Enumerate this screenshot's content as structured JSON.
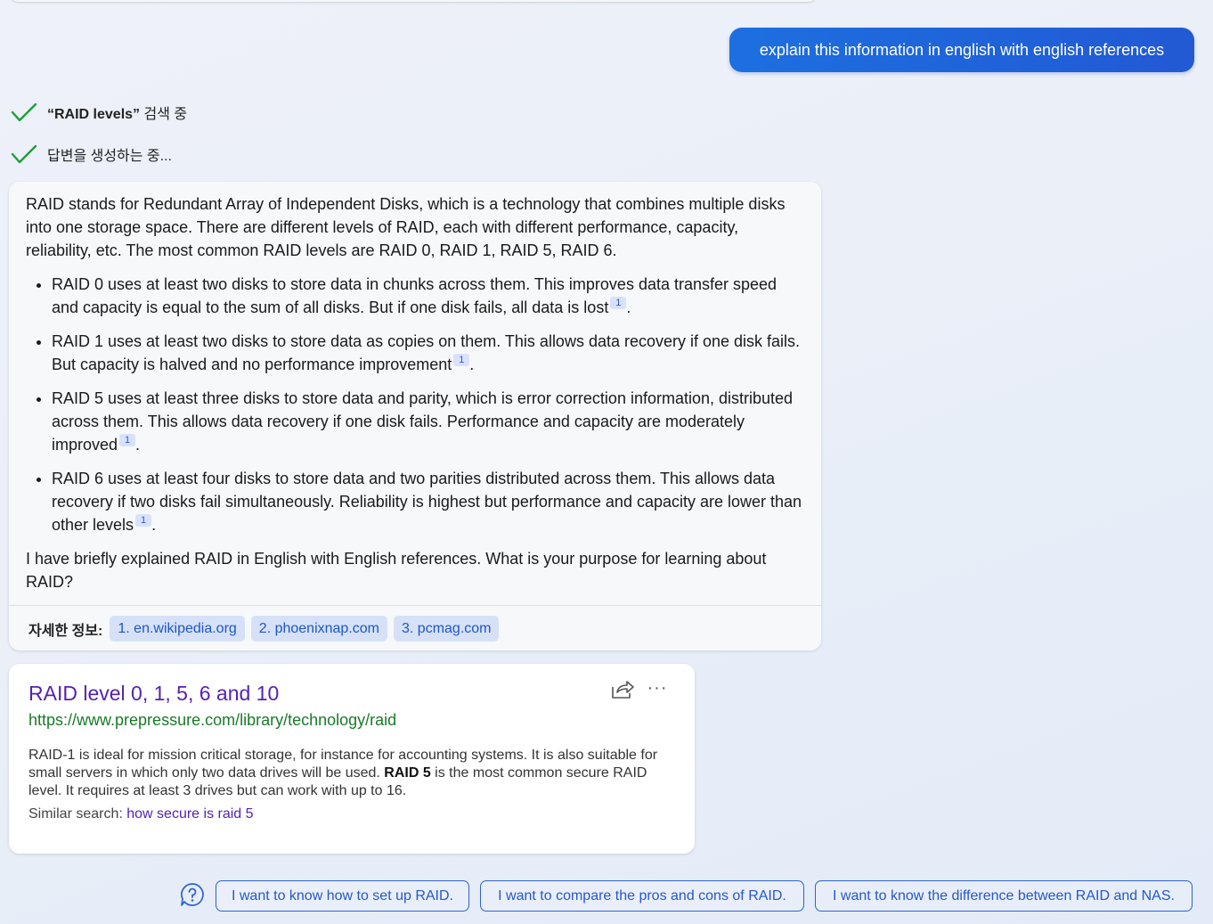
{
  "user_message": "explain this information in english with english references",
  "status": [
    {
      "bold": "“RAID levels”",
      "text": " 검색 중"
    },
    {
      "bold": "",
      "text": "답변을 생성하는 중..."
    }
  ],
  "answer": {
    "intro": "RAID stands for Redundant Array of Independent Disks, which is a technology that combines multiple disks into one storage space. There are different levels of RAID, each with different performance, capacity, reliability, etc. The most common RAID levels are RAID 0, RAID 1, RAID 5, RAID 6.",
    "bullets": [
      {
        "text": "RAID 0 uses at least two disks to store data in chunks across them. This improves data transfer speed and capacity is equal to the sum of all disks. But if one disk fails, all data is lost",
        "cite": "1"
      },
      {
        "text": "RAID 1 uses at least two disks to store data as copies on them. This allows data recovery if one disk fails. But capacity is halved and no performance improvement",
        "cite": "1"
      },
      {
        "text": "RAID 5 uses at least three disks to store data and parity, which is error correction information, distributed across them. This allows data recovery if one disk fails. Performance and capacity are moderately improved",
        "cite": "1"
      },
      {
        "text": "RAID 6 uses at least four disks to store data and two parities distributed across them. This allows data recovery if two disks fail simultaneously. Reliability is highest but performance and capacity are lower than other levels",
        "cite": "1"
      }
    ],
    "outro": "I have briefly explained RAID in English with English references. What is your purpose for learning about RAID?",
    "refs_label": "자세한 정보:",
    "refs": [
      "1. en.wikipedia.org",
      "2. phoenixnap.com",
      "3. pcmag.com"
    ]
  },
  "result": {
    "title": "RAID level 0, 1, 5, 6 and 10",
    "url": "https://www.prepressure.com/library/technology/raid",
    "snippet_before": "RAID-1 is ideal for mission critical storage, for instance for accounting systems. It is also suitable for small servers in which only two data drives will be used. ",
    "snippet_bold": "RAID 5",
    "snippet_after": " is the most common secure RAID level. It requires at least 3 drives but can work with up to 16.",
    "similar_label": "Similar search: ",
    "similar_link": "how secure is raid 5",
    "more_label": "···"
  },
  "suggestions": [
    "I want to know how to set up RAID.",
    "I want to compare the pros and cons of RAID.",
    "I want to know the difference between RAID and NAS."
  ],
  "colors": {
    "accent": "#1d6fe0",
    "check": "#1e9e3a",
    "link_visited": "#5522b3",
    "url": "#1a7a2a"
  }
}
